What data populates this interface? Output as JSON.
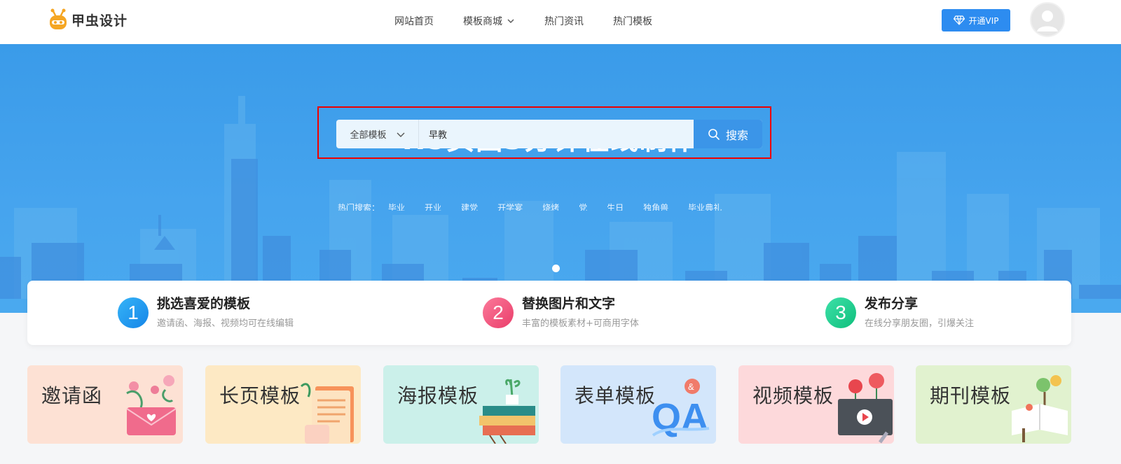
{
  "header": {
    "logo_text": "甲虫设计",
    "nav": [
      {
        "label": "网站首页"
      },
      {
        "label": "模板商城",
        "has_dropdown": true
      },
      {
        "label": "热门资讯"
      },
      {
        "label": "热门模板"
      }
    ],
    "vip_label": "开通VIP",
    "colors": {
      "vip": "#2d8cf0"
    }
  },
  "hero": {
    "title": "H5页面3分钟在线制作",
    "search": {
      "scope_label": "全部模板",
      "value": "早教",
      "button_label": "搜索"
    },
    "hot": {
      "label": "热门搜索：",
      "items": [
        "毕业",
        "开业",
        "建党",
        "开学宴",
        "烧烤",
        "党",
        "生日",
        "独角兽",
        "毕业典礼"
      ]
    },
    "carousel": {
      "slides": 1,
      "active": 1
    }
  },
  "steps": [
    {
      "number": "1",
      "title": "挑选喜爱的模板",
      "desc": "邀请函、海报、视频均可在线编辑",
      "color": "#1e9bf0"
    },
    {
      "number": "2",
      "title": "替换图片和文字",
      "desc": "丰富的模板素材+可商用字体",
      "color": "#f0507a"
    },
    {
      "number": "3",
      "title": "发布分享",
      "desc": "在线分享朋友圈，引爆关注",
      "color": "#1ecf8f"
    }
  ],
  "categories": [
    {
      "label": "邀请函",
      "bg": "#fde1d4"
    },
    {
      "label": "长页模板",
      "bg": "#fde9c4"
    },
    {
      "label": "海报模板",
      "bg": "#cbf0ea"
    },
    {
      "label": "表单模板",
      "bg": "#d3e6fb"
    },
    {
      "label": "视频模板",
      "bg": "#fdd9db"
    },
    {
      "label": "期刊模板",
      "bg": "#e1f2cf"
    }
  ]
}
